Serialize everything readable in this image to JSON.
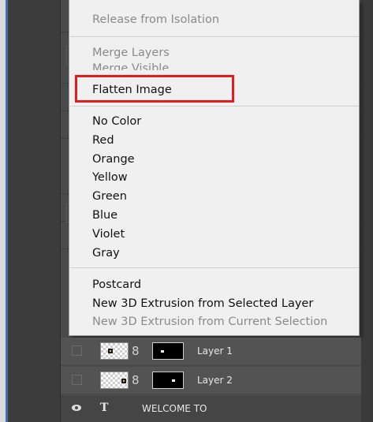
{
  "menu": {
    "items": [
      {
        "label": "Release from Isolation",
        "enabled": false
      },
      {
        "label": "Merge Layers",
        "enabled": false
      },
      {
        "label": "Merge Visible",
        "enabled": false
      },
      {
        "label": "Flatten Image",
        "enabled": true,
        "highlighted": true
      },
      {
        "label": "No Color",
        "enabled": true
      },
      {
        "label": "Red",
        "enabled": true
      },
      {
        "label": "Orange",
        "enabled": true
      },
      {
        "label": "Yellow",
        "enabled": true
      },
      {
        "label": "Green",
        "enabled": true
      },
      {
        "label": "Blue",
        "enabled": true
      },
      {
        "label": "Violet",
        "enabled": true
      },
      {
        "label": "Gray",
        "enabled": true
      },
      {
        "label": "Postcard",
        "enabled": true
      },
      {
        "label": "New 3D Extrusion from Selected Layer",
        "enabled": true
      },
      {
        "label": "New 3D Extrusion from Current Selection",
        "enabled": false
      }
    ],
    "highlight_color": "#e31c1c"
  },
  "layers": [
    {
      "name": "Layer 1",
      "visible": false
    },
    {
      "name": "Layer 2",
      "visible": false
    },
    {
      "name": "WELCOME TO",
      "visible": true,
      "type": "text",
      "type_icon": "T"
    }
  ],
  "icons": {
    "visibility": "eye-icon",
    "text_layer": "text-layer-icon",
    "link": "link-chain-icon"
  },
  "chain_glyph": "8"
}
